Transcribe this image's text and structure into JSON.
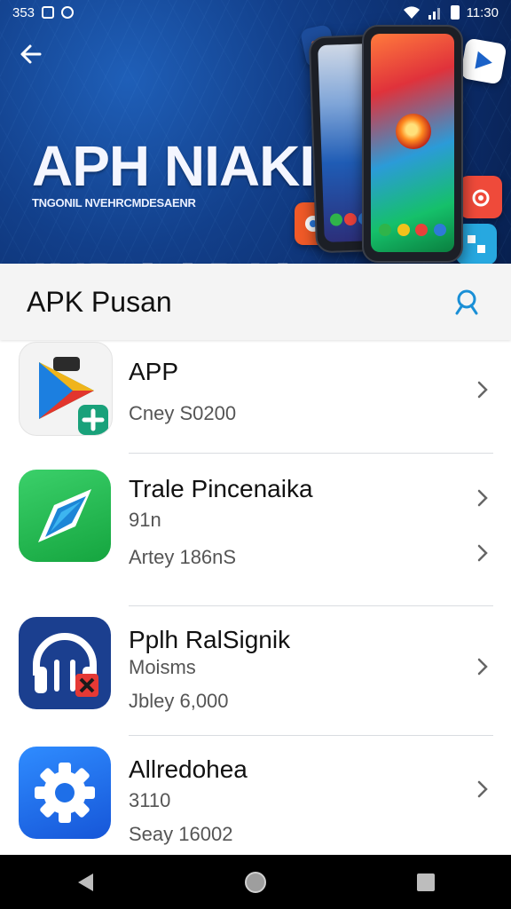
{
  "status_bar": {
    "left_text": "353",
    "time": "11:30"
  },
  "banner": {
    "title_line1": "APH NIAKI",
    "title_line2": "INDAADIA",
    "subtitle": "TNGONIL NVEHRCMDESAENR"
  },
  "app_bar": {
    "title": "APK Pusan"
  },
  "apps": [
    {
      "title": "APP",
      "subtitle": "Cney S0200"
    },
    {
      "title": "Trale Pincenaika",
      "line2": "91n",
      "line3": "Artey 186nS"
    },
    {
      "title": "Pplh RalSignik",
      "line2": "Moisms",
      "line3": "Jbley 6,000"
    },
    {
      "title": "Allredohea",
      "line2": "3110",
      "line3": "Seay 16002"
    }
  ],
  "colors": {
    "banner_bg": "#123f8a",
    "accent": "#1a8fd6",
    "green_icon": "#1fb34a",
    "navy_icon": "#1b3f8f",
    "blue_icon": "#1e6fe8"
  }
}
